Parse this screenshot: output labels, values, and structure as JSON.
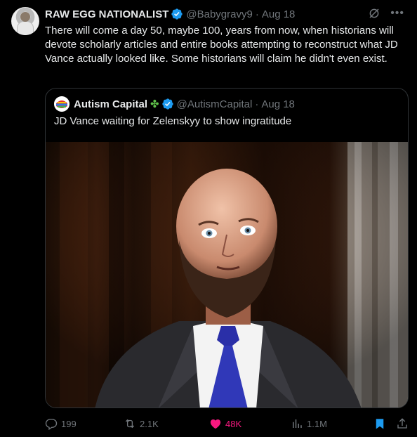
{
  "tweet": {
    "author_name": "RAW EGG NATIONALIST",
    "handle": "@Babygravy9",
    "separator": "·",
    "date": "Aug 18",
    "text": "There will come a day 50, maybe 100, years from now, when historians will devote scholarly articles and entire books attempting to reconstruct what JD Vance actually looked like. Some historians will claim he didn't even exist."
  },
  "quoted": {
    "author_name": "Autism Capital",
    "emoji": "✤",
    "handle": "@AutismCapital",
    "separator": "·",
    "date": "Aug 18",
    "text": "JD Vance waiting for Zelenskyy to show ingratitude",
    "media_description_icon": "photo"
  },
  "actions": {
    "replies": "199",
    "reposts": "2.1K",
    "likes": "48K",
    "views": "1.1M"
  },
  "colors": {
    "background": "#000000",
    "text": "#e7e9ea",
    "muted": "#71767b",
    "verified": "#1d9bf0",
    "like": "#f91880",
    "bookmark": "#1d9bf0",
    "border": "#2f3336"
  },
  "icons": {
    "verified": "verified-badge-icon",
    "grok": "grok-icon",
    "more": "more-icon",
    "reply": "reply-icon",
    "repost": "repost-icon",
    "like": "heart-icon",
    "views": "views-icon",
    "bookmark": "bookmark-icon",
    "share": "share-icon"
  }
}
